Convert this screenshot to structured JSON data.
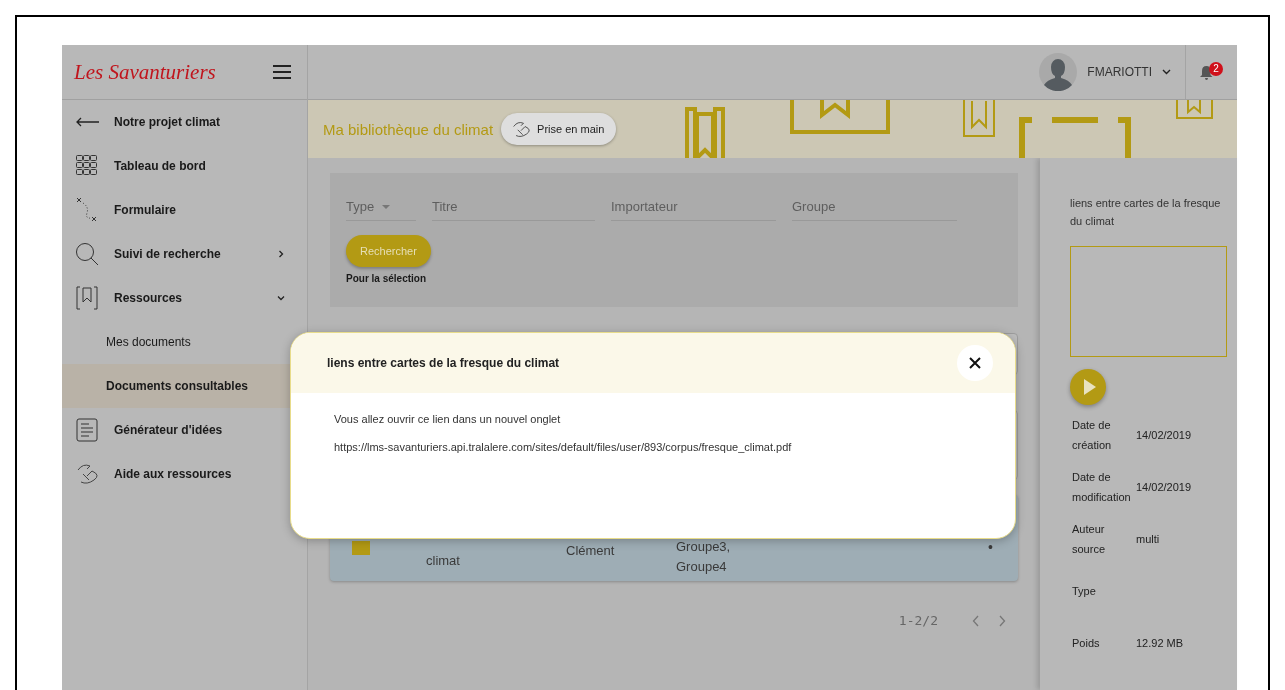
{
  "logo": "Les Savanturiers",
  "user": {
    "name": "FMARIOTTI",
    "notifications": "2"
  },
  "sidebar": {
    "items": [
      {
        "label": "Notre projet climat"
      },
      {
        "label": "Tableau de bord"
      },
      {
        "label": "Formulaire"
      },
      {
        "label": "Suivi de recherche",
        "expanded": false
      },
      {
        "label": "Ressources",
        "expanded": true,
        "children": [
          {
            "label": "Mes documents",
            "selected": false
          },
          {
            "label": "Documents consultables",
            "selected": true
          }
        ]
      },
      {
        "label": "Générateur d'idées"
      },
      {
        "label": "Aide aux ressources"
      }
    ]
  },
  "banner": {
    "title": "Ma bibliothèque du climat",
    "help_button": "Prise en main"
  },
  "filters": {
    "type": {
      "placeholder": "Type"
    },
    "fields": [
      {
        "placeholder": "Titre"
      },
      {
        "placeholder": "Importateur"
      },
      {
        "placeholder": "Groupe"
      }
    ],
    "search_button": "Rechercher",
    "selection_label": "Pour la sélection"
  },
  "table": {
    "rows": [
      {
        "checked": true,
        "title": "climat",
        "importer": "Clément",
        "groups": "Groupe3, Groupe4",
        "menu": "•"
      }
    ]
  },
  "pagination": {
    "range": "1-2/2"
  },
  "details": {
    "title": "liens entre cartes de la fresque du climat",
    "fields": [
      {
        "label": "Date de création",
        "value": "14/02/2019"
      },
      {
        "label": "Date de modification",
        "value": "14/02/2019"
      },
      {
        "label": "Auteur source",
        "value": "multi"
      },
      {
        "label": "Type"
      },
      {
        "label": "Poids",
        "value": "12.92 MB"
      }
    ]
  },
  "modal": {
    "title": "liens entre cartes de la fresque du climat",
    "message": "Vous allez ouvrir ce lien dans un nouvel onglet",
    "url": "https://lms-savanturiers.api.tralalere.com/sites/default/files/user/893/corpus/fresque_climat.pdf"
  }
}
